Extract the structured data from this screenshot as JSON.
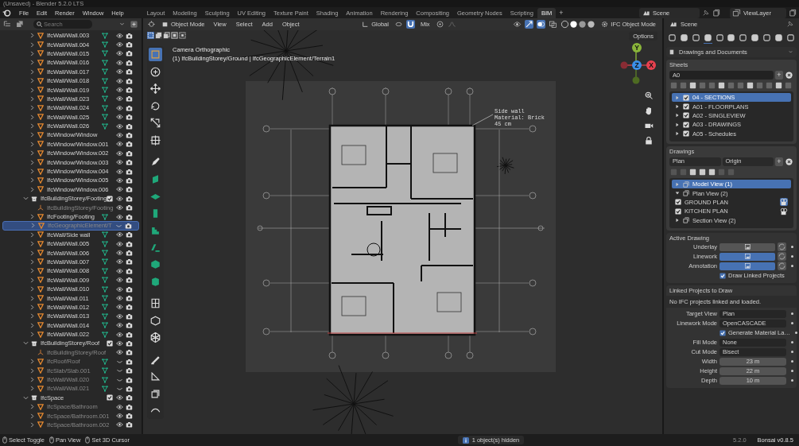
{
  "window": {
    "title": "(Unsaved) - Blender 5.2.0 LTS"
  },
  "menus": [
    "File",
    "Edit",
    "Render",
    "Window",
    "Help"
  ],
  "workspaces": [
    {
      "label": "Layout",
      "selected": false
    },
    {
      "label": "Modeling",
      "selected": false
    },
    {
      "label": "Sculpting",
      "selected": false
    },
    {
      "label": "UV Editing",
      "selected": false
    },
    {
      "label": "Texture Paint",
      "selected": false
    },
    {
      "label": "Shading",
      "selected": false
    },
    {
      "label": "Animation",
      "selected": false
    },
    {
      "label": "Rendering",
      "selected": false
    },
    {
      "label": "Compositing",
      "selected": false
    },
    {
      "label": "Geometry Nodes",
      "selected": false
    },
    {
      "label": "Scripting",
      "selected": false
    },
    {
      "label": "BIM",
      "selected": true
    }
  ],
  "add_workspace": "+",
  "scene": "Scene",
  "view_layer": "ViewLayer",
  "outliner": {
    "search": {
      "placeholder": "Search"
    },
    "continued_rows": [
      {
        "label": "IfcWall/Wall.003",
        "kind": "object",
        "mesh": true,
        "muted": false,
        "visible": true,
        "selected": false
      },
      {
        "label": "IfcWall/Wall.004",
        "kind": "object",
        "mesh": true,
        "muted": false,
        "visible": true,
        "selected": false
      },
      {
        "label": "IfcWall/Wall.015",
        "kind": "object",
        "mesh": true,
        "muted": false,
        "visible": true,
        "selected": false
      },
      {
        "label": "IfcWall/Wall.016",
        "kind": "object",
        "mesh": true,
        "muted": false,
        "visible": true,
        "selected": false
      },
      {
        "label": "IfcWall/Wall.017",
        "kind": "object",
        "mesh": true,
        "muted": false,
        "visible": true,
        "selected": false
      },
      {
        "label": "IfcWall/Wall.018",
        "kind": "object",
        "mesh": true,
        "muted": false,
        "visible": true,
        "selected": false
      },
      {
        "label": "IfcWall/Wall.019",
        "kind": "object",
        "mesh": true,
        "muted": false,
        "visible": true,
        "selected": false
      },
      {
        "label": "IfcWall/Wall.023",
        "kind": "object",
        "mesh": true,
        "muted": false,
        "visible": true,
        "selected": false
      },
      {
        "label": "IfcWall/Wall.024",
        "kind": "object",
        "mesh": true,
        "muted": false,
        "visible": true,
        "selected": false
      },
      {
        "label": "IfcWall/Wall.025",
        "kind": "object",
        "mesh": true,
        "muted": false,
        "visible": true,
        "selected": false
      },
      {
        "label": "IfcWall/Wall.026",
        "kind": "object",
        "mesh": true,
        "muted": false,
        "visible": true,
        "selected": false
      },
      {
        "label": "IfcWindow/Window",
        "kind": "object",
        "mesh": false,
        "muted": false,
        "visible": true,
        "selected": false
      },
      {
        "label": "IfcWindow/Window.001",
        "kind": "object",
        "mesh": false,
        "muted": false,
        "visible": true,
        "selected": false
      },
      {
        "label": "IfcWindow/Window.002",
        "kind": "object",
        "mesh": false,
        "muted": false,
        "visible": true,
        "selected": false
      },
      {
        "label": "IfcWindow/Window.003",
        "kind": "object",
        "mesh": false,
        "muted": false,
        "visible": true,
        "selected": false
      },
      {
        "label": "IfcWindow/Window.004",
        "kind": "object",
        "mesh": false,
        "muted": false,
        "visible": true,
        "selected": false
      },
      {
        "label": "IfcWindow/Window.005",
        "kind": "object",
        "mesh": false,
        "muted": false,
        "visible": true,
        "selected": false
      },
      {
        "label": "IfcWindow/Window.006",
        "kind": "object",
        "mesh": false,
        "muted": false,
        "visible": true,
        "selected": false
      }
    ],
    "collections": [
      {
        "label": "IfcBuildingStorey/Footing",
        "kind": "collection",
        "expanded": true,
        "checked": true,
        "muted": false,
        "visible": true,
        "selected": false,
        "children": [
          {
            "label": "IfcBuildingStorey/Footing",
            "kind": "empty",
            "mesh": false,
            "muted": true,
            "visible": true,
            "selected": false
          },
          {
            "label": "IfcFooting/Footing",
            "kind": "object",
            "mesh": true,
            "muted": false,
            "visible": true,
            "selected": false
          },
          {
            "label": "IfcGeographicElement/T",
            "kind": "object",
            "mesh": false,
            "muted": true,
            "visible": false,
            "selected": true
          },
          {
            "label": "IfcWall/Side wall",
            "kind": "object",
            "mesh": true,
            "muted": false,
            "visible": true,
            "selected": false
          },
          {
            "label": "IfcWall/Wall.005",
            "kind": "object",
            "mesh": true,
            "muted": false,
            "visible": true,
            "selected": false
          },
          {
            "label": "IfcWall/Wall.006",
            "kind": "object",
            "mesh": true,
            "muted": false,
            "visible": true,
            "selected": false
          },
          {
            "label": "IfcWall/Wall.007",
            "kind": "object",
            "mesh": true,
            "muted": false,
            "visible": true,
            "selected": false
          },
          {
            "label": "IfcWall/Wall.008",
            "kind": "object",
            "mesh": true,
            "muted": false,
            "visible": true,
            "selected": false
          },
          {
            "label": "IfcWall/Wall.009",
            "kind": "object",
            "mesh": true,
            "muted": false,
            "visible": true,
            "selected": false
          },
          {
            "label": "IfcWall/Wall.010",
            "kind": "object",
            "mesh": true,
            "muted": false,
            "visible": true,
            "selected": false
          },
          {
            "label": "IfcWall/Wall.011",
            "kind": "object",
            "mesh": true,
            "muted": false,
            "visible": true,
            "selected": false
          },
          {
            "label": "IfcWall/Wall.012",
            "kind": "object",
            "mesh": true,
            "muted": false,
            "visible": true,
            "selected": false
          },
          {
            "label": "IfcWall/Wall.013",
            "kind": "object",
            "mesh": true,
            "muted": false,
            "visible": true,
            "selected": false
          },
          {
            "label": "IfcWall/Wall.014",
            "kind": "object",
            "mesh": true,
            "muted": false,
            "visible": true,
            "selected": false
          },
          {
            "label": "IfcWall/Wall.022",
            "kind": "object",
            "mesh": true,
            "muted": false,
            "visible": true,
            "selected": false
          }
        ]
      },
      {
        "label": "IfcBuildingStorey/Roof",
        "kind": "collection",
        "expanded": true,
        "checked": true,
        "muted": false,
        "visible": true,
        "selected": false,
        "children": [
          {
            "label": "IfcBuildingStorey/Roof",
            "kind": "empty",
            "mesh": false,
            "muted": true,
            "visible": true,
            "selected": false
          },
          {
            "label": "IfcRoof/Roof",
            "kind": "object",
            "mesh": true,
            "muted": true,
            "visible": false,
            "selected": false
          },
          {
            "label": "IfcSlab/Slab.001",
            "kind": "object",
            "mesh": true,
            "muted": true,
            "visible": false,
            "selected": false
          },
          {
            "label": "IfcWall/Wall.020",
            "kind": "object",
            "mesh": true,
            "muted": true,
            "visible": false,
            "selected": false
          },
          {
            "label": "IfcWall/Wall.021",
            "kind": "object",
            "mesh": true,
            "muted": true,
            "visible": false,
            "selected": false
          }
        ]
      },
      {
        "label": "IfcSpace",
        "kind": "collection",
        "expanded": true,
        "checked": true,
        "muted": false,
        "visible": true,
        "selected": false,
        "children": [
          {
            "label": "IfcSpace/Bathroom",
            "kind": "object",
            "mesh": false,
            "muted": true,
            "visible": true,
            "selected": false
          },
          {
            "label": "IfcSpace/Bathroom.001",
            "kind": "object",
            "mesh": false,
            "muted": true,
            "visible": true,
            "selected": false
          },
          {
            "label": "IfcSpace/Bathroom.002",
            "kind": "object",
            "mesh": false,
            "muted": true,
            "visible": true,
            "selected": false
          }
        ]
      }
    ]
  },
  "viewport": {
    "mode": "Object Mode",
    "menus": [
      "View",
      "Select",
      "Add",
      "Object"
    ],
    "orientation": "Global",
    "snap": "Mix",
    "ifc_mode": "IFC Object Mode",
    "options": "Options",
    "camera": "Camera Orthographic",
    "context": "(1) IfcBuildingStorey/Ground | IfcGeographicElement/Terrain1",
    "axes": [
      {
        "label": "Y",
        "color": "#8ab53a"
      },
      {
        "label": "Z",
        "color": "#3b8fe8"
      },
      {
        "label": "X",
        "color": "#e8414f"
      }
    ],
    "annotation": [
      "Side wall",
      "Material: Brick",
      "45 cm"
    ]
  },
  "properties": {
    "title": "Scene",
    "tabs": [
      {
        "selected": false
      },
      {
        "selected": false
      },
      {
        "selected": false
      },
      {
        "selected": true
      },
      {
        "selected": false
      },
      {
        "selected": false
      },
      {
        "selected": false
      },
      {
        "selected": false
      },
      {
        "selected": false
      },
      {
        "selected": false
      },
      {
        "selected": false
      }
    ],
    "panel": "Drawings and Documents",
    "sheets": {
      "title": "Sheets",
      "name": "A0",
      "add": "+",
      "items": [
        {
          "label": "04 - SECTIONS",
          "checked": true,
          "selected": true
        },
        {
          "label": "A01 - FLOORPLANS",
          "checked": true,
          "selected": false
        },
        {
          "label": "A02 - SINGLEVIEW",
          "checked": true,
          "selected": false
        },
        {
          "label": "A03 - DRAWINGS",
          "checked": true,
          "selected": false
        },
        {
          "label": "A05 - Schedules",
          "checked": true,
          "selected": false
        }
      ]
    },
    "drawings": {
      "title": "Drawings",
      "target": "Plan",
      "location": "Origin",
      "add": "+",
      "items": [
        {
          "label": "Model View (1)",
          "expanded": false,
          "selected": true
        },
        {
          "label": "Plan View (2)",
          "expanded": true,
          "selected": false,
          "children": [
            {
              "label": "GROUND PLAN",
              "checked": true,
              "active": true
            },
            {
              "label": "KITCHEN PLAN",
              "checked": true,
              "active": false
            }
          ]
        },
        {
          "label": "Section View (2)",
          "expanded": false,
          "selected": false
        }
      ]
    },
    "active_drawing": {
      "title": "Active Drawing",
      "layers": [
        {
          "label": "Underlay",
          "on": false
        },
        {
          "label": "Linework",
          "on": true
        },
        {
          "label": "Annotation",
          "on": true
        }
      ],
      "draw_linked": {
        "label": "Draw Linked Projects",
        "checked": true
      }
    },
    "linked": {
      "title": "Linked Projects to Draw",
      "message": "No IFC projects linked and loaded.",
      "fields": [
        {
          "kind": "select",
          "label": "Target View",
          "value": "Plan"
        },
        {
          "kind": "select",
          "label": "Linework Mode",
          "value": "OpenCASCADE"
        },
        {
          "kind": "checkbox",
          "label": "Generate Material La…",
          "checked": true
        },
        {
          "kind": "select",
          "label": "Fill Mode",
          "value": "None"
        },
        {
          "kind": "select",
          "label": "Cut Mode",
          "value": "Bisect"
        },
        {
          "kind": "number",
          "label": "Width",
          "value": "23 m"
        },
        {
          "kind": "number",
          "label": "Height",
          "value": "22 m"
        },
        {
          "kind": "number",
          "label": "Depth",
          "value": "10 m"
        }
      ]
    }
  },
  "status_bar": {
    "hints": [
      "Select Toggle",
      "Pan View",
      "Set 3D Cursor"
    ],
    "notice": "1 object(s) hidden",
    "version": "5.2.0",
    "addon": "Bonsai v0.8.5"
  }
}
